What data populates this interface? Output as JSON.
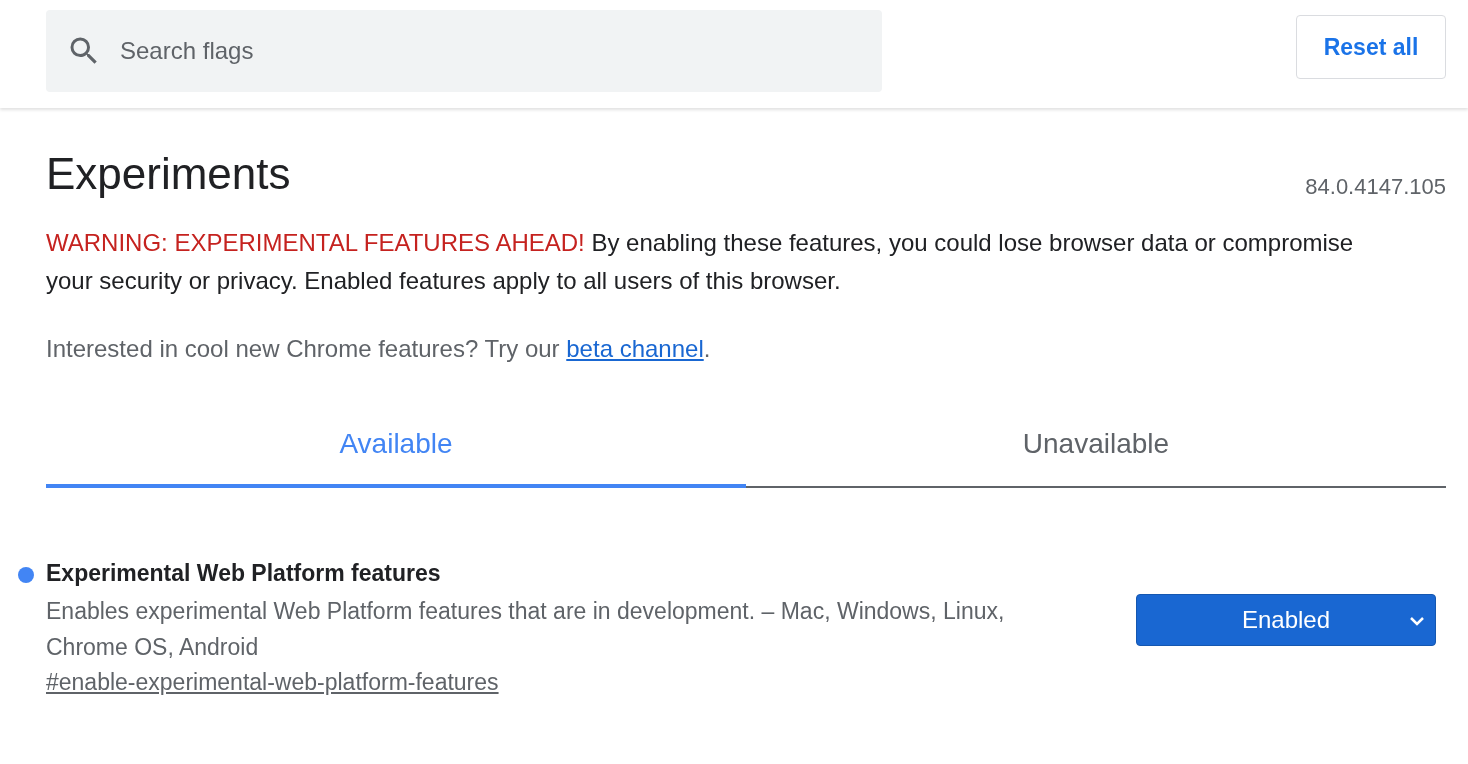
{
  "search": {
    "placeholder": "Search flags"
  },
  "reset_button": "Reset all",
  "title": "Experiments",
  "version": "84.0.4147.105",
  "warning": {
    "label": "WARNING: EXPERIMENTAL FEATURES AHEAD!",
    "text": "By enabling these features, you could lose browser data or compromise your security or privacy. Enabled features apply to all users of this browser."
  },
  "interest": {
    "text": "Interested in cool new Chrome features? Try our",
    "link": "beta channel",
    "suffix": "."
  },
  "tabs": [
    {
      "label": "Available",
      "selected": true
    },
    {
      "label": "Unavailable",
      "selected": false
    }
  ],
  "flags": [
    {
      "title": "Experimental Web Platform features",
      "modified": true,
      "description": "Enables experimental Web Platform features that are in development. – Mac, Windows, Linux, Chrome OS, Android",
      "link": "#enable-experimental-web-platform-features",
      "value": "Enabled"
    }
  ]
}
